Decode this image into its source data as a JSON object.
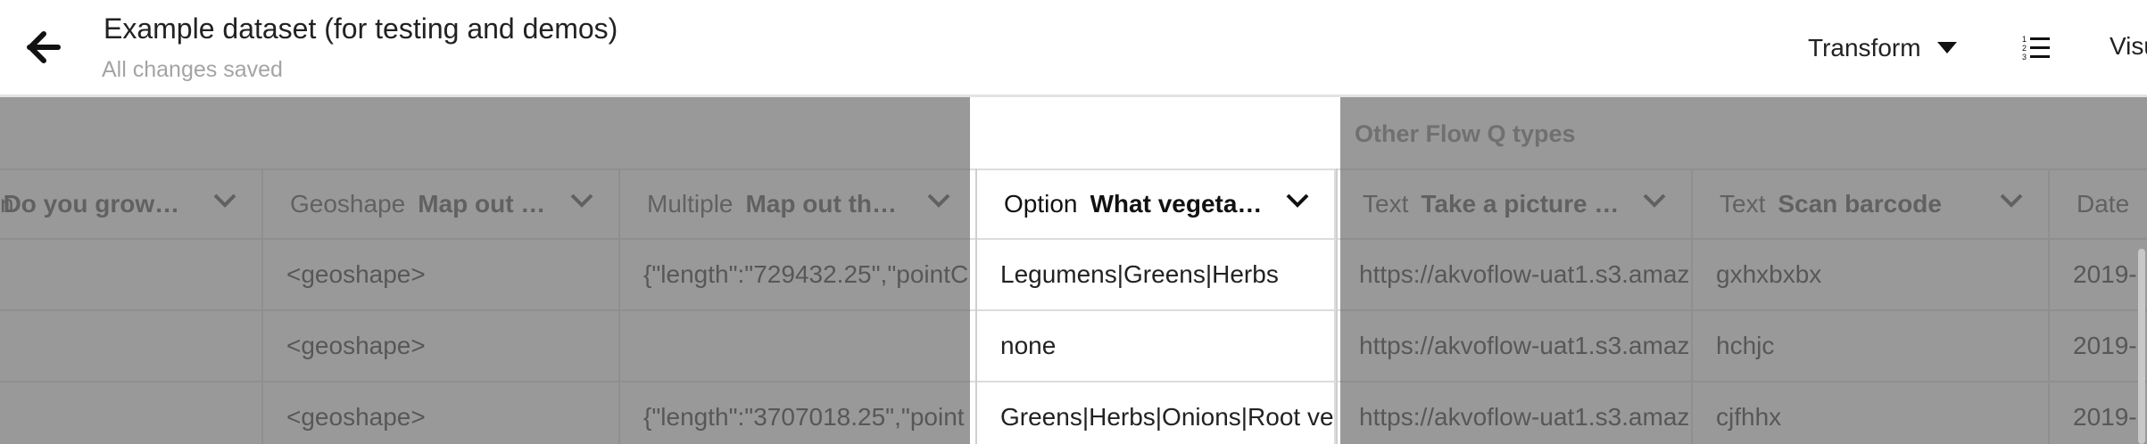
{
  "header": {
    "title": "Example dataset (for testing and demos)",
    "status": "All changes saved",
    "transform_label": "Transform",
    "visualise_label": "Visu"
  },
  "groups": {
    "other_flow": "Other Flow Q types"
  },
  "columns": [
    {
      "type": "n",
      "name": "Do you grow…"
    },
    {
      "type": "Geoshape",
      "name": "Map out …"
    },
    {
      "type": "Multiple",
      "name": "Map out th…"
    },
    {
      "type": "Option",
      "name": "What vegeta…"
    },
    {
      "type": "Text",
      "name": "Take a picture …"
    },
    {
      "type": "Text",
      "name": "Scan barcode"
    },
    {
      "type": "Date",
      "name": ""
    }
  ],
  "rows": [
    [
      "",
      "<geoshape>",
      "{\"length\":\"729432.25\",\"pointC",
      "Legumens|Greens|Herbs",
      "https://akvoflow-uat1.s3.amaz",
      "gxhxbxbx",
      "2019-"
    ],
    [
      "",
      "<geoshape>",
      "",
      "none",
      "https://akvoflow-uat1.s3.amaz",
      "hchjc",
      "2019-"
    ],
    [
      "",
      "<geoshape>",
      "{\"length\":\"3707018.25\",\"point",
      "Greens|Herbs|Onions|Root veg",
      "https://akvoflow-uat1.s3.amaz",
      "cjfhhx",
      "2019-"
    ]
  ],
  "icons": {
    "back": "arrow-left-icon",
    "transform_caret": "caret-down-icon",
    "list": "numbered-list-icon",
    "column_menu": "chevron-down-icon"
  },
  "colors": {
    "overlay": "#6e6e6e",
    "header_text": "#222222",
    "muted_text": "#a4a4a4",
    "grid_line": "#dcdcdc"
  }
}
